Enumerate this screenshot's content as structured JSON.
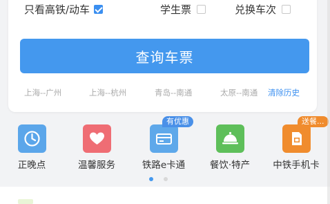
{
  "options": {
    "high_speed": {
      "label": "只看高铁/动车",
      "checked": true
    },
    "student": {
      "label": "学生票",
      "checked": false
    },
    "exchange": {
      "label": "兑换车次",
      "checked": false
    }
  },
  "query_button": "查询车票",
  "history": [
    "上海--广州",
    "上海--杭州",
    "青岛--南通",
    "太原--南通"
  ],
  "clear_history": "清除历史",
  "shortcuts": [
    {
      "label": "正晚点",
      "icon": "clock-icon",
      "color": "#5ba6ea"
    },
    {
      "label": "温馨服务",
      "icon": "heart-icon",
      "color": "#ef6d74"
    },
    {
      "label": "铁路e卡通",
      "icon": "card-icon",
      "color": "#5ea8ea",
      "badge": "有优惠"
    },
    {
      "label": "餐饮·特产",
      "icon": "dining-bell-icon",
      "color": "#5ebf5a"
    },
    {
      "label": "中铁手机卡",
      "icon": "sim-card-icon",
      "color": "#f08c2e",
      "badge": "送餐..."
    }
  ],
  "carousel": {
    "pages": 2,
    "active": 0
  },
  "colors": {
    "accent": "#4498ee",
    "badge_blue": "#4a90e8",
    "badge_orange": "#f08c2e"
  }
}
